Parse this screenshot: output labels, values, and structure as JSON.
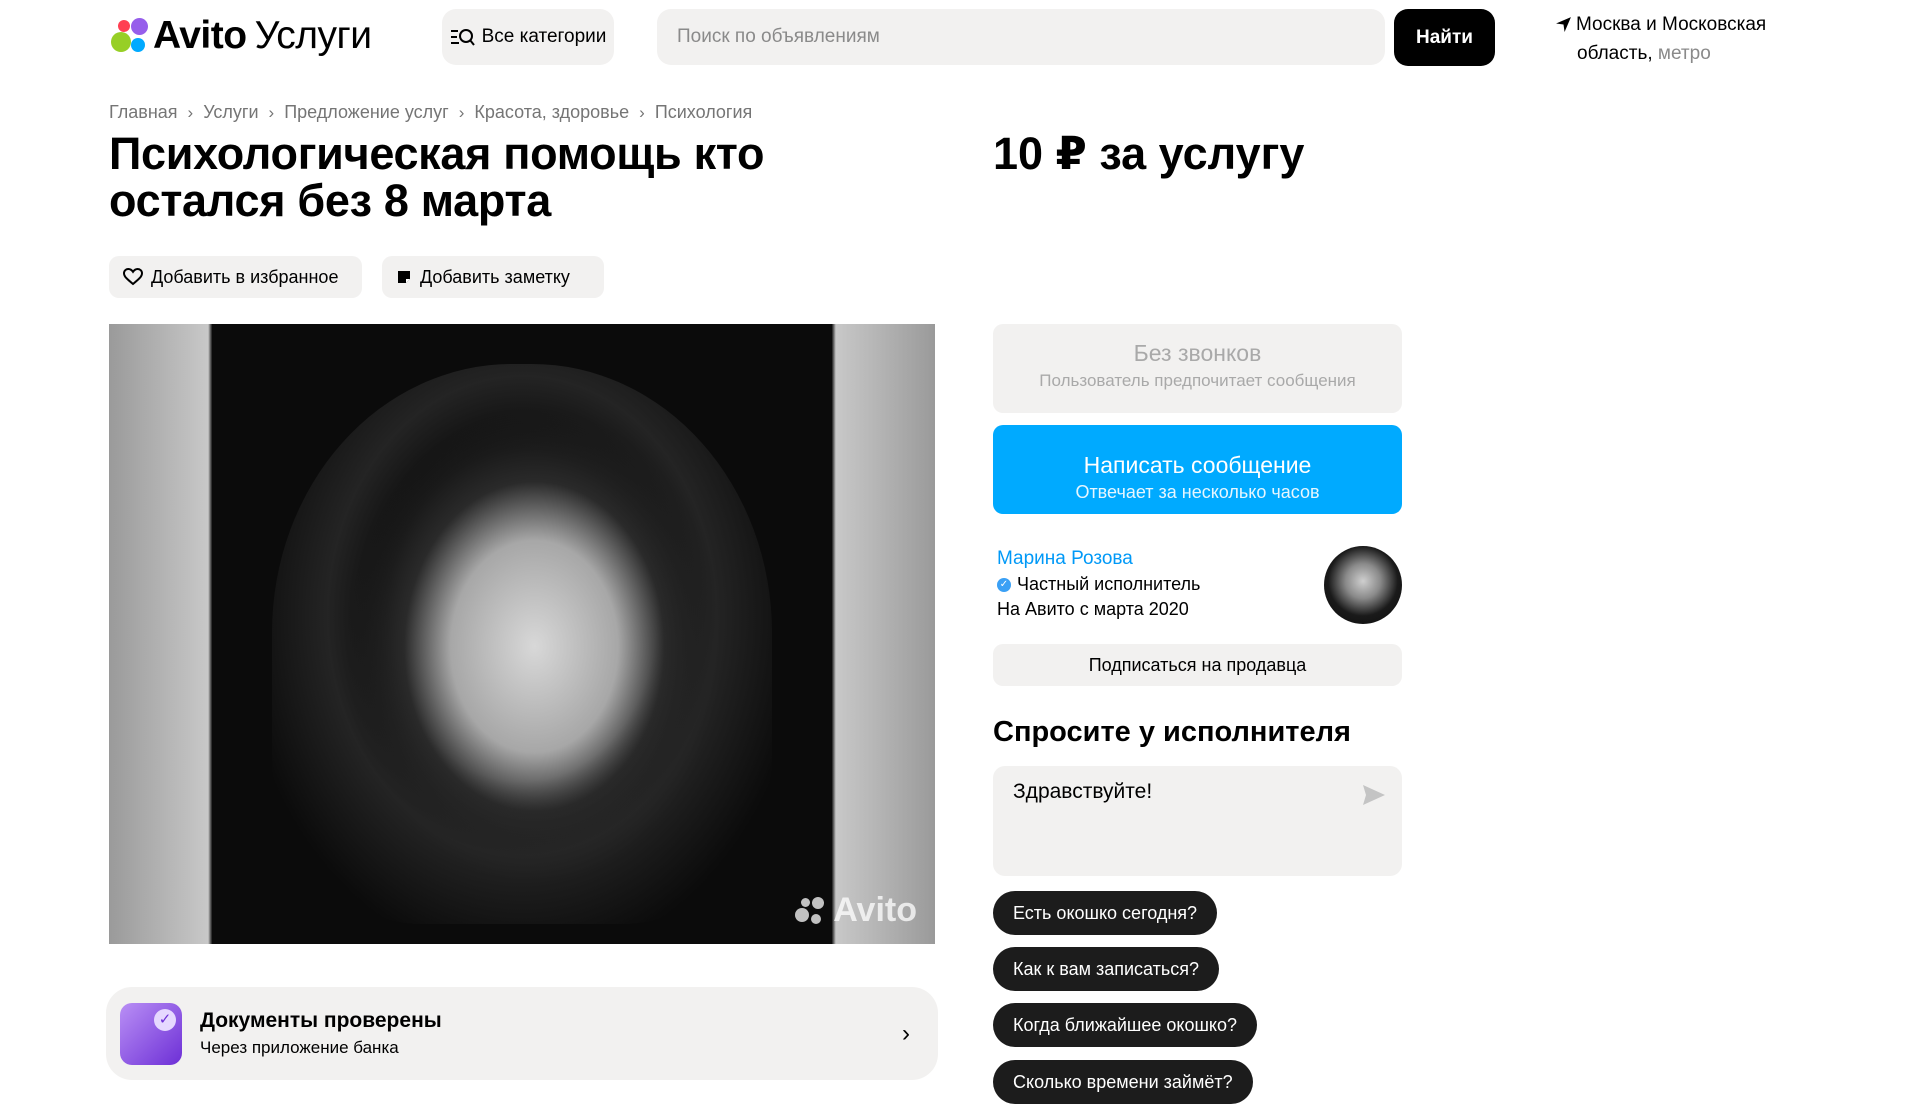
{
  "header": {
    "logo_brand": "Avito",
    "logo_service": "Услуги",
    "categories_label": "Все категории",
    "search_placeholder": "Поиск по объявлениям",
    "search_button": "Найти",
    "location_line1": "Москва и Московская",
    "location_line2": "область,",
    "location_metro": "метро"
  },
  "breadcrumb": [
    "Главная",
    "Услуги",
    "Предложение услуг",
    "Красота, здоровье",
    "Психология"
  ],
  "listing": {
    "title": "Психологическая помощь кто остался без 8 марта",
    "price": "10 ₽ за услугу",
    "favorite_label": "Добавить в избранное",
    "note_label": "Добавить заметку",
    "watermark": "Avito"
  },
  "documents": {
    "title": "Документы проверены",
    "subtitle": "Через приложение банка"
  },
  "contact": {
    "no_calls_title": "Без звонков",
    "no_calls_sub": "Пользователь предпочитает сообщения",
    "write_title": "Написать сообщение",
    "write_sub": "Отвечает за несколько часов"
  },
  "seller": {
    "name": "Марина Розова",
    "type": "Частный исполнитель",
    "since": "На Авито с марта 2020",
    "subscribe_label": "Подписаться на продавца"
  },
  "ask": {
    "title": "Спросите у исполнителя",
    "message": "Здравствуйте!",
    "chips": [
      "Есть окошко сегодня?",
      "Как к вам записаться?",
      "Когда ближайшее окошко?",
      "Сколько времени займёт?"
    ]
  },
  "colors": {
    "accent_blue": "#00aaff",
    "link_blue": "#0099f7",
    "surface": "#f2f1f0",
    "dark": "#000000"
  },
  "icons": [
    "logo-dots-icon",
    "categories-search-icon",
    "location-arrow-icon",
    "heart-icon",
    "note-icon",
    "verified-icon",
    "chevron-right-icon",
    "send-icon",
    "documents-check-icon"
  ]
}
